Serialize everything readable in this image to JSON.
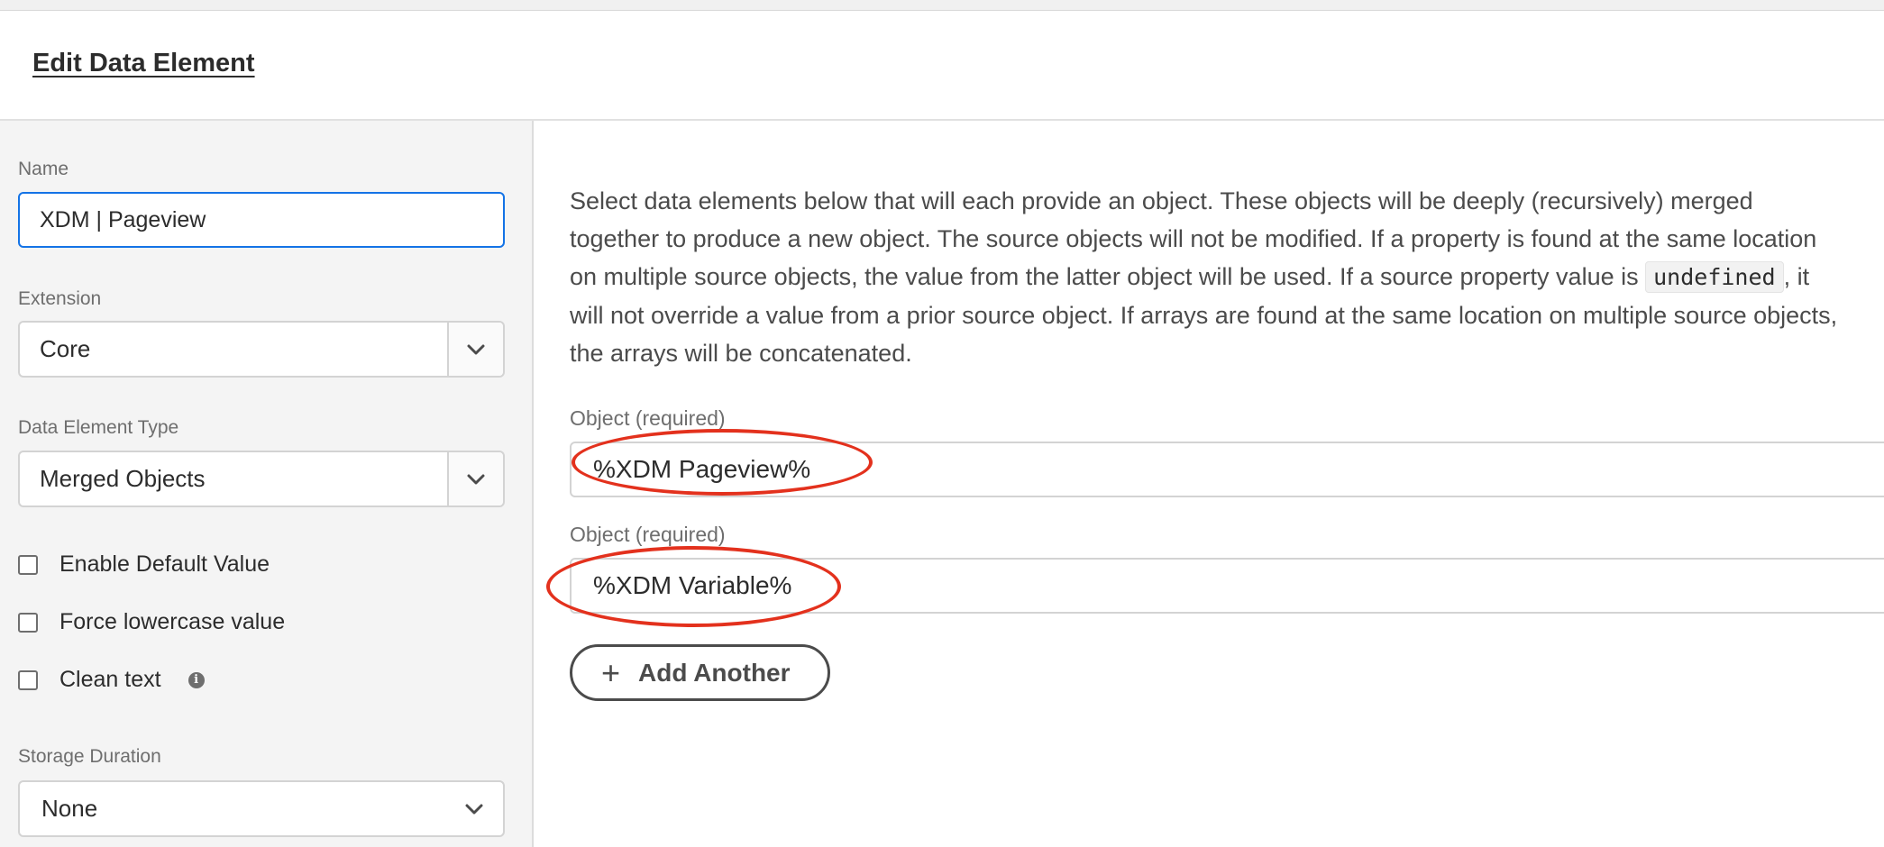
{
  "header": {
    "title": "Edit Data Element"
  },
  "sidebar": {
    "name": {
      "label": "Name",
      "value": "XDM | Pageview"
    },
    "extension": {
      "label": "Extension",
      "value": "Core"
    },
    "data_element_type": {
      "label": "Data Element Type",
      "value": "Merged Objects"
    },
    "checkboxes": [
      {
        "label": "Enable Default Value",
        "checked": false
      },
      {
        "label": "Force lowercase value",
        "checked": false
      },
      {
        "label": "Clean text",
        "checked": false
      }
    ],
    "storage_duration": {
      "label": "Storage Duration",
      "value": "None"
    }
  },
  "main": {
    "description": {
      "part1": "Select data elements below that will each provide an object. These objects will be deeply (recursively) merged together to produce a new object. The source objects will not be modified. If a property is found at the same location on multiple source objects, the value from the latter object will be used. If a source property value is ",
      "code": "undefined",
      "part2": ", it will not override a value from a prior source object. If arrays are found at the same location on multiple source objects, the arrays will be concatenated."
    },
    "objects": [
      {
        "label": "Object (required)",
        "value": "%XDM Pageview%"
      },
      {
        "label": "Object (required)",
        "value": "%XDM Variable%"
      }
    ],
    "add_button_label": "Add Another"
  },
  "colors": {
    "accent": "#1473e6",
    "annotation": "#e3311d",
    "sidebar_bg": "#f4f4f4"
  }
}
